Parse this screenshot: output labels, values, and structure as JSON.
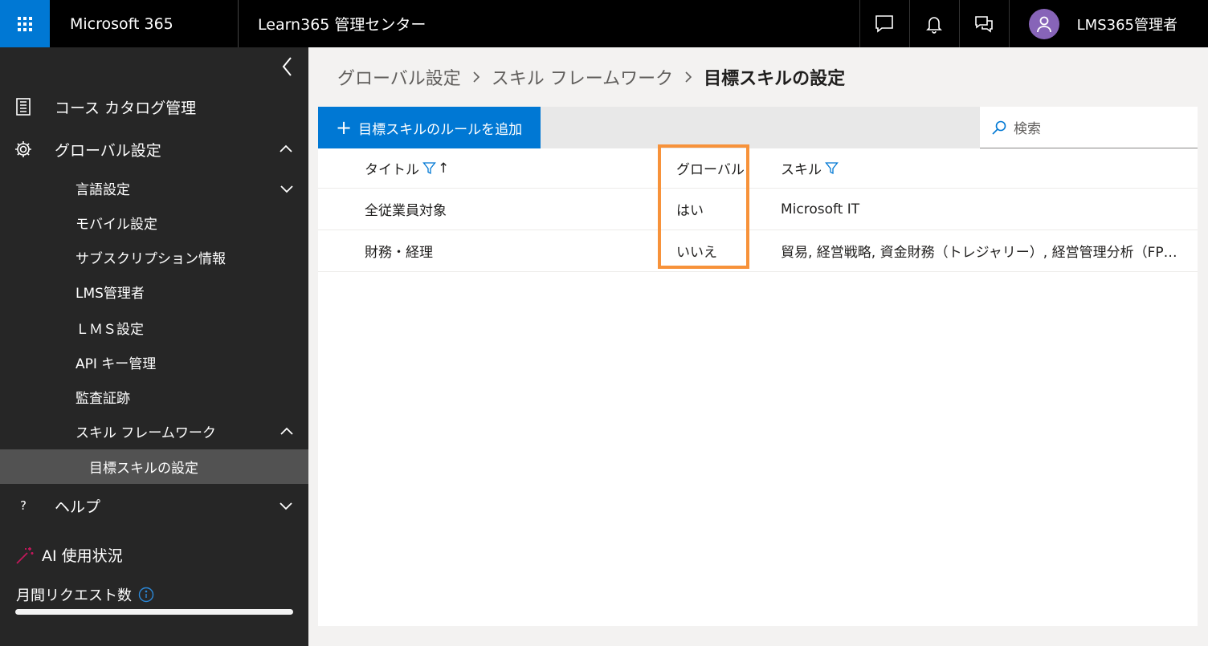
{
  "topbar": {
    "brand": "Microsoft 365",
    "app_name": "Learn365 管理センター",
    "account_name": "LMS365管理者"
  },
  "sidebar": {
    "items": [
      {
        "label": "コース カタログ管理",
        "icon": "catalog-icon"
      },
      {
        "label": "グローバル設定",
        "icon": "gear-icon"
      }
    ],
    "sub_items": [
      {
        "label": "言語設定"
      },
      {
        "label": "モバイル設定"
      },
      {
        "label": "サブスクリプション情報"
      },
      {
        "label": "LMS管理者"
      },
      {
        "label": "ＬＭＳ設定"
      },
      {
        "label": "API キー管理"
      },
      {
        "label": "監査証跡"
      },
      {
        "label": "スキル フレームワーク"
      }
    ],
    "selected": {
      "label": "目標スキルの設定"
    },
    "help": {
      "label": "ヘルプ",
      "icon_glyph": "?"
    },
    "ai_usage": {
      "label": "AI 使用状況"
    },
    "monthly_requests": {
      "label": "月間リクエスト数",
      "progress": 1.0
    }
  },
  "breadcrumb": {
    "items": [
      "グローバル設定",
      "スキル フレームワーク"
    ],
    "current": "目標スキルの設定"
  },
  "toolbar": {
    "add_label": "目標スキルのルールを追加",
    "search_placeholder": "検索"
  },
  "table": {
    "columns": {
      "title": "タイトル",
      "global": "グローバル",
      "skill": "スキル"
    },
    "sort_glyph": "↑",
    "rows": [
      {
        "title": "全従業員対象",
        "global": "はい",
        "skill": "Microsoft IT"
      },
      {
        "title": "財務・経理",
        "global": "いいえ",
        "skill": "貿易, 経営戦略, 資金財務（トレジャリー）, 経営管理分析（FP&A..."
      }
    ]
  },
  "colors": {
    "accent": "#0078d4",
    "highlight": "#f7923a",
    "avatar": "#8764b8",
    "sidebar": "#262626"
  }
}
